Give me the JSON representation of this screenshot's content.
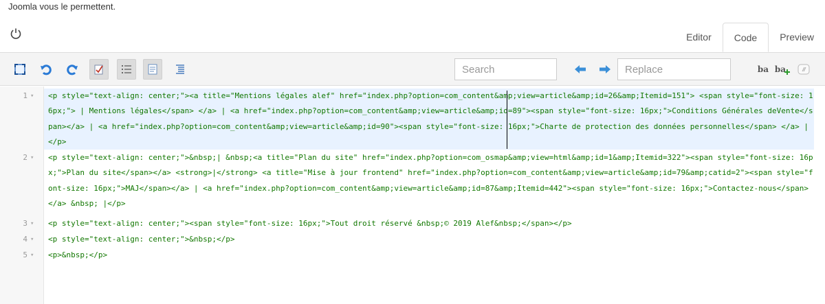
{
  "intro_text": "Joomla vous le permettent.",
  "tabs": [
    {
      "label": "Editor",
      "active": false
    },
    {
      "label": "Code",
      "active": true
    },
    {
      "label": "Preview",
      "active": false
    }
  ],
  "toolbar": {
    "buttons": [
      {
        "name": "fullscreen-icon",
        "pressed": false
      },
      {
        "name": "undo-icon",
        "pressed": false
      },
      {
        "name": "redo-icon",
        "pressed": false
      },
      {
        "name": "spellcheck-icon",
        "pressed": true
      },
      {
        "name": "line-numbers-icon",
        "pressed": true
      },
      {
        "name": "wrap-lines-icon",
        "pressed": true
      },
      {
        "name": "format-code-icon",
        "pressed": false
      }
    ],
    "search_placeholder": "Search",
    "replace_placeholder": "Replace",
    "replace_label": "ba",
    "replace_all_label": "ba"
  },
  "code_lines": [
    {
      "num": "1",
      "text": "<p style=\"text-align: center;\"><a title=\"Mentions légales alef\" href=\"index.php?option=com_content&amp;view=article&amp;id=26&amp;Itemid=151\"> <span style=\"font-size: 16px;\"> | Mentions légales</span> </a> | <a href=\"index.php?option=com_content&amp;view=article&amp;id=89\"><span style=\"font-size: 16px;\">Conditions Générales deVente</span></a> | <a href=\"index.php?option=com_content&amp;view=article&amp;id=90\"><span style=\"font-size: 16px;\">Charte de protection des données personnelles</span> </a> |</p>"
    },
    {
      "num": "2",
      "text": "<p style=\"text-align: center;\">&nbsp;| &nbsp;<a title=\"Plan du site\" href=\"index.php?option=com_osmap&amp;view=html&amp;id=1&amp;Itemid=322\"><span style=\"font-size: 16px;\">Plan du site</span></a> <strong>|</strong> <a title=\"Mise à jour frontend\" href=\"index.php?option=com_content&amp;view=article&amp;id=79&amp;catid=2\"><span style=\"font-size: 16px;\">MAJ</span></a> | <a href=\"index.php?option=com_content&amp;view=article&amp;id=87&amp;Itemid=442\"><span style=\"font-size: 16px;\">Contactez-nous</span></a> &nbsp; |</p>"
    },
    {
      "num": "3",
      "text": "<p style=\"text-align: center;\"><span style=\"font-size: 16px;\">Tout droit réservé &nbsp;© 2019 Alef&nbsp;</span></p>"
    },
    {
      "num": "4",
      "text": "<p style=\"text-align: center;\">&nbsp;</p>"
    },
    {
      "num": "5",
      "text": "<p>&nbsp;</p>"
    }
  ],
  "colors": {
    "tag": "#117700",
    "active_line": "#e8f2ff",
    "arrow": "#3b8fd8"
  }
}
